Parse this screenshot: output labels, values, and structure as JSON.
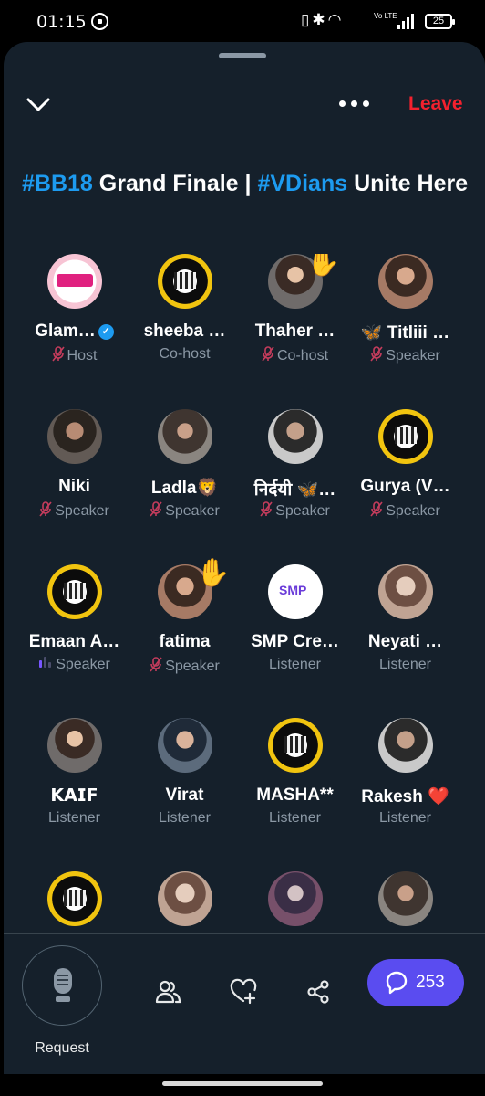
{
  "status_bar": {
    "time": "01:15",
    "volte": "Vo LTE",
    "battery": "25"
  },
  "header": {
    "leave_label": "Leave"
  },
  "title": {
    "tag1": "#BB18",
    "text1": " Grand Finale | ",
    "tag2": "#VDians",
    "text2": " Unite Here"
  },
  "participants": [
    {
      "name": "Glam…",
      "role": "Host",
      "verified": true,
      "muted": true
    },
    {
      "name": "sheeba …",
      "role": "Co-host",
      "muted": false
    },
    {
      "name": "Thaher …",
      "role": "Co-host",
      "muted": true,
      "hand_raised": true
    },
    {
      "name": "🦋 Titliii …",
      "role": "Speaker",
      "muted": true
    },
    {
      "name": "Niki",
      "role": "Speaker",
      "muted": true
    },
    {
      "name": "Ladla🦁",
      "role": "Speaker",
      "muted": true
    },
    {
      "name": "निर्दयी 🦋…",
      "role": "Speaker",
      "muted": true
    },
    {
      "name": "Gurya (V…",
      "role": "Speaker",
      "muted": true
    },
    {
      "name": "Emaan A…",
      "role": "Speaker",
      "speaking": true
    },
    {
      "name": "fatima",
      "role": "Speaker",
      "muted": true,
      "hand_raised": true
    },
    {
      "name": "SMP Cre…",
      "role": "Listener"
    },
    {
      "name": "Neyati …",
      "role": "Listener"
    },
    {
      "name": "𝗞𝗔𝗜𝗙",
      "role": "Listener"
    },
    {
      "name": "Virat",
      "role": "Listener"
    },
    {
      "name": "MASHA**",
      "role": "Listener"
    },
    {
      "name": "Rakesh ❤️",
      "role": "Listener"
    }
  ],
  "bottom": {
    "request_label": "Request",
    "comment_count": "253"
  },
  "colors": {
    "background": "#15202b",
    "accent": "#1d9bf0",
    "leave": "#f4212e",
    "comments_pill": "#5a4cf0"
  }
}
